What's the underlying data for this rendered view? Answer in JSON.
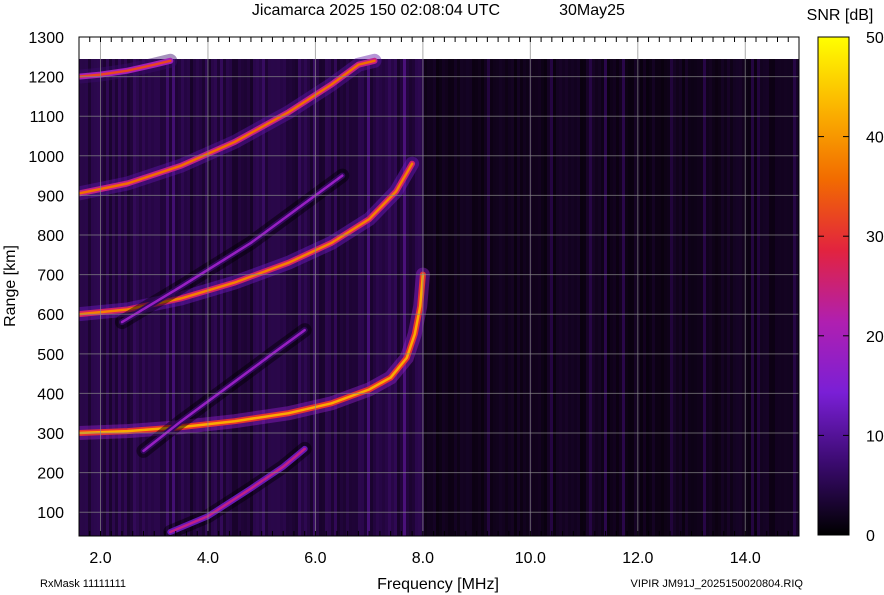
{
  "chart_data": {
    "type": "heatmap",
    "title": "Jicamarca 2025 150 02:08:04 UTC",
    "date_label": "30May25",
    "xlabel": "Frequency [MHz]",
    "ylabel": "Range [km]",
    "xlim": [
      1.6,
      15.0
    ],
    "ylim": [
      40,
      1300
    ],
    "x_ticks": [
      2.0,
      4.0,
      6.0,
      8.0,
      10.0,
      12.0,
      14.0
    ],
    "x_tick_labels": [
      "2.0",
      "4.0",
      "6.0",
      "8.0",
      "10.0",
      "12.0",
      "14.0"
    ],
    "y_ticks": [
      100,
      200,
      300,
      400,
      500,
      600,
      700,
      800,
      900,
      1000,
      1100,
      1200,
      1300
    ],
    "y_tick_labels": [
      "100",
      "200",
      "300",
      "400",
      "500",
      "600",
      "700",
      "800",
      "900",
      "1000",
      "1100",
      "1200",
      "1300"
    ],
    "grid": true,
    "colorbar": {
      "title": "SNR [dB]",
      "range": [
        0,
        50
      ],
      "ticks": [
        0,
        10,
        20,
        30,
        40,
        50
      ],
      "tick_labels": [
        "0",
        "10",
        "20",
        "30",
        "40",
        "50"
      ],
      "colormap": [
        "#000000",
        "#3a0a6e",
        "#7a1fd6",
        "#b01fb0",
        "#e2233f",
        "#f26b00",
        "#fbb400",
        "#ffff00"
      ]
    },
    "series": [
      {
        "name": "",
        "trace": "1-hop F trace",
        "points": [
          [
            1.6,
            300
          ],
          [
            2.5,
            305
          ],
          [
            3.5,
            315
          ],
          [
            4.5,
            330
          ],
          [
            5.5,
            350
          ],
          [
            6.3,
            375
          ],
          [
            7.0,
            410
          ],
          [
            7.4,
            440
          ],
          [
            7.7,
            490
          ],
          [
            7.85,
            550
          ],
          [
            7.95,
            620
          ],
          [
            8.0,
            700
          ]
        ],
        "snr_db": 42
      },
      {
        "name": "",
        "trace": "2-hop F trace",
        "points": [
          [
            1.6,
            600
          ],
          [
            2.5,
            612
          ],
          [
            3.5,
            640
          ],
          [
            4.5,
            680
          ],
          [
            5.5,
            730
          ],
          [
            6.3,
            780
          ],
          [
            7.0,
            840
          ],
          [
            7.5,
            910
          ],
          [
            7.8,
            980
          ]
        ],
        "snr_db": 38
      },
      {
        "name": "",
        "trace": "3-hop F trace",
        "points": [
          [
            1.6,
            905
          ],
          [
            2.5,
            930
          ],
          [
            3.5,
            975
          ],
          [
            4.5,
            1035
          ],
          [
            5.5,
            1110
          ],
          [
            6.3,
            1180
          ],
          [
            6.8,
            1230
          ],
          [
            7.1,
            1240
          ]
        ],
        "snr_db": 36
      },
      {
        "name": "",
        "trace": "4-hop F trace",
        "points": [
          [
            1.6,
            1200
          ],
          [
            2.0,
            1205
          ],
          [
            2.5,
            1215
          ],
          [
            3.0,
            1230
          ],
          [
            3.3,
            1240
          ]
        ],
        "snr_db": 32
      },
      {
        "name": "",
        "trace": "low oblique trace",
        "points": [
          [
            3.3,
            50
          ],
          [
            4.0,
            90
          ],
          [
            4.8,
            160
          ],
          [
            5.4,
            215
          ],
          [
            5.8,
            260
          ]
        ],
        "snr_db": 24
      },
      {
        "name": "",
        "trace": "mid oblique trace",
        "points": [
          [
            2.8,
            255
          ],
          [
            3.5,
            330
          ],
          [
            4.3,
            410
          ],
          [
            5.2,
            500
          ],
          [
            5.8,
            560
          ]
        ],
        "snr_db": 18
      },
      {
        "name": "",
        "trace": "upper oblique trace",
        "points": [
          [
            2.4,
            580
          ],
          [
            3.5,
            670
          ],
          [
            4.8,
            780
          ],
          [
            5.8,
            880
          ],
          [
            6.5,
            950
          ]
        ],
        "snr_db": 18
      }
    ]
  },
  "footer": {
    "left": "RxMask 11111111",
    "right": "VIPIR  JM91J_2025150020804.RIQ"
  }
}
